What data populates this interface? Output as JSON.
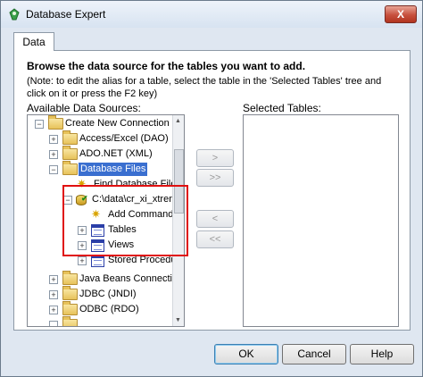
{
  "window": {
    "title": "Database Expert",
    "close_label": "X"
  },
  "tabs": [
    {
      "label": "Data",
      "active": true
    }
  ],
  "panel": {
    "heading": "Browse the data source for the tables you want to add.",
    "note": "(Note: to edit the alias for a table, select the table in the 'Selected Tables' tree and click on it or press the F2 key)",
    "available_label": "Available Data Sources:",
    "selected_label": "Selected Tables:"
  },
  "tree": {
    "items": [
      {
        "label": "Create New Connection",
        "icon": "folder-icon",
        "expander": "−"
      },
      {
        "label": "Access/Excel (DAO)",
        "icon": "folder-icon",
        "expander": "+"
      },
      {
        "label": "ADO.NET (XML)",
        "icon": "folder-icon",
        "expander": "+"
      },
      {
        "label": "Database Files",
        "icon": "folder-icon",
        "expander": "−",
        "selected": true
      },
      {
        "label": "Find Database File",
        "icon": "find-file-icon"
      },
      {
        "label": "C:\\data\\cr_xi_xtrem",
        "icon": "database-icon",
        "expander": "−"
      },
      {
        "label": "Add Command",
        "icon": "add-command-icon"
      },
      {
        "label": "Tables",
        "icon": "table-icon",
        "expander": "+"
      },
      {
        "label": "Views",
        "icon": "table-icon",
        "expander": "+"
      },
      {
        "label": "Stored Procedu",
        "icon": "table-icon",
        "expander": "+"
      },
      {
        "label": "Java Beans Connectivit",
        "icon": "folder-icon",
        "expander": "+"
      },
      {
        "label": "JDBC (JNDI)",
        "icon": "folder-icon",
        "expander": "+"
      },
      {
        "label": "ODBC (RDO)",
        "icon": "folder-icon",
        "expander": "+"
      }
    ]
  },
  "move_buttons": {
    "add_one": ">",
    "add_all": ">>",
    "remove_one": "<",
    "remove_all": "<<"
  },
  "dialog_buttons": {
    "ok": "OK",
    "cancel": "Cancel",
    "help": "Help"
  },
  "colors": {
    "selection": "#3a6fd0",
    "highlight_frame": "#e01010"
  }
}
